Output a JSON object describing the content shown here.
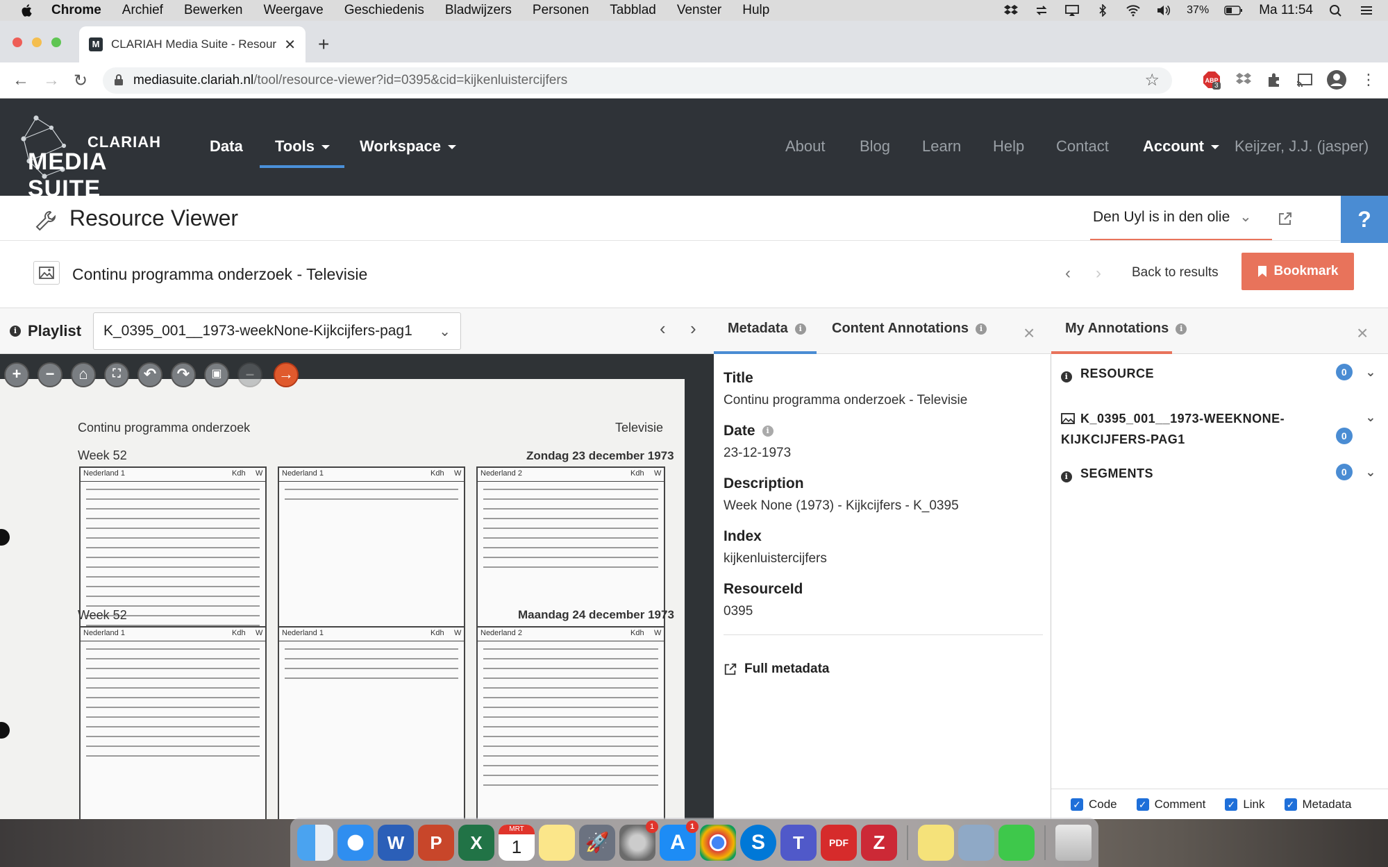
{
  "macos": {
    "menu": [
      "Chrome",
      "Archief",
      "Bewerken",
      "Weergave",
      "Geschiedenis",
      "Bladwijzers",
      "Personen",
      "Tabblad",
      "Venster",
      "Hulp"
    ],
    "battery": "37%",
    "clock": "Ma 11:54"
  },
  "browser": {
    "tab_title": "CLARIAH Media Suite - Resour",
    "url_host": "mediasuite.clariah.nl",
    "url_path": "/tool/resource-viewer?id=0395&cid=kijkenluistercijfers",
    "ext_badge": "3"
  },
  "navbar": {
    "logo_top": "CLARIAH",
    "logo_bottom": "MEDIA SUITE",
    "data": "Data",
    "tools": "Tools",
    "workspace": "Workspace",
    "about": "About",
    "blog": "Blog",
    "learn": "Learn",
    "help": "Help",
    "contact": "Contact",
    "account": "Account",
    "user": "Keijzer, J.J. (jasper)"
  },
  "header": {
    "title": "Resource Viewer",
    "collection": "Den Uyl is in den olie",
    "help_glyph": "?",
    "resource_title": "Continu programma onderzoek - Televisie",
    "back_to_results": "Back to results",
    "bookmark": "Bookmark"
  },
  "playlist": {
    "label": "Playlist",
    "selected": "K_0395_001__1973-weekNone-Kijkcijfers-pag1"
  },
  "document": {
    "header_left": "Continu programma onderzoek",
    "header_right": "Televisie",
    "week1": "Week  52",
    "date1": "Zondag 23 december 1973",
    "week2": "Week  52",
    "date2": "Maandag 24 december 1973",
    "col_nl1": "Nederland 1",
    "col_nl2": "Nederland 2",
    "col_kdh": "Kdh",
    "col_w": "W"
  },
  "metadata": {
    "tab_metadata": "Metadata",
    "tab_content": "Content Annotations",
    "fields": [
      {
        "label": "Title",
        "value": "Continu programma onderzoek - Televisie"
      },
      {
        "label": "Date",
        "value": "23-12-1973"
      },
      {
        "label": "Description",
        "value": "Week None (1973) - Kijkcijfers - K_0395"
      },
      {
        "label": "Index",
        "value": "kijkenluistercijfers"
      },
      {
        "label": "ResourceId",
        "value": "0395"
      }
    ],
    "full_metadata": "Full metadata"
  },
  "annotations": {
    "tab": "My Annotations",
    "resource_label": "RESOURCE",
    "resource_count": "0",
    "item_line1": "K_0395_001__1973-WEEKNONE-",
    "item_line2": "KIJKCIJFERS-PAG1",
    "item_count": "0",
    "segments_label": "SEGMENTS",
    "segments_count": "0",
    "filters": [
      "Code",
      "Comment",
      "Link",
      "Metadata"
    ]
  },
  "dock": {
    "calendar_month": "MRT",
    "calendar_day": "1",
    "settings_badge": "1",
    "appstore_badge": "1"
  }
}
